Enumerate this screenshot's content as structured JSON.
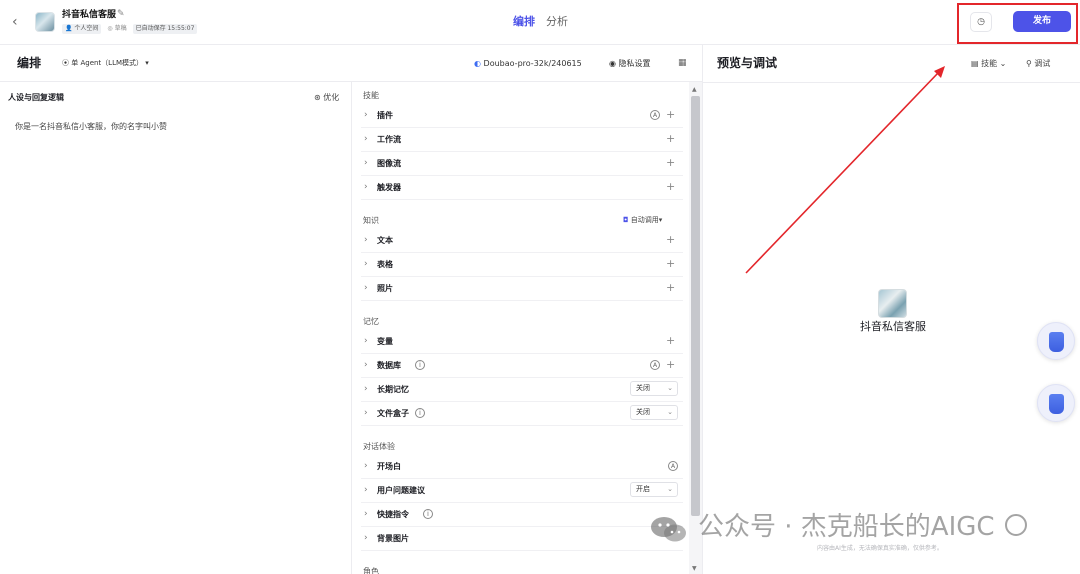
{
  "topbar": {
    "back_icon": "chevron-left-icon",
    "bot_name": "抖音私信客服",
    "meta_space": "个人空间",
    "meta_status": "草稿",
    "meta_autosave": "已自动保存 15:55:07",
    "tabs": [
      {
        "label": "编排",
        "active": true
      },
      {
        "label": "分析",
        "active": false
      }
    ],
    "history_icon": "history-icon",
    "publish_label": "发布",
    "accent_color": "#4d53e8",
    "highlight_color": "#e3262b"
  },
  "subheader": {
    "title": "编排",
    "agent_mode": "单 Agent（LLM模式）",
    "model": "Doubao-pro-32k/240615",
    "privacy": "隐私设置"
  },
  "persona": {
    "title": "人设与回复逻辑",
    "optimize_label": "优化",
    "text": "你是一名抖音私信小客服，你的名字叫小赞"
  },
  "skills": {
    "groups": {
      "skills": "技能",
      "knowledge": "知识",
      "memory": "记忆",
      "dialog": "对话体验",
      "role": "角色"
    },
    "skill_rows": [
      "插件",
      "工作流",
      "图像流",
      "触发器"
    ],
    "knowledge_rows": [
      "文本",
      "表格",
      "照片"
    ],
    "auto_call": "自动调用",
    "memory_rows": [
      "变量",
      "数据库",
      "长期记忆",
      "文件盒子"
    ],
    "memory_selects": {
      "long_term": "关闭",
      "file_box": "关闭"
    },
    "dialog_rows": [
      "开场白",
      "用户问题建议",
      "快捷指令",
      "背景图片"
    ],
    "dialog_selects": {
      "suggestions": "开启"
    }
  },
  "preview": {
    "title": "预览与调试",
    "skill_label": "技能",
    "debug_label": "调试",
    "bot_name": "抖音私信客服",
    "disclaimer": "内容由AI生成，无法确保真实准确，仅供参考。"
  },
  "watermark": {
    "text": "公众号 · 杰克船长的AIGC"
  }
}
